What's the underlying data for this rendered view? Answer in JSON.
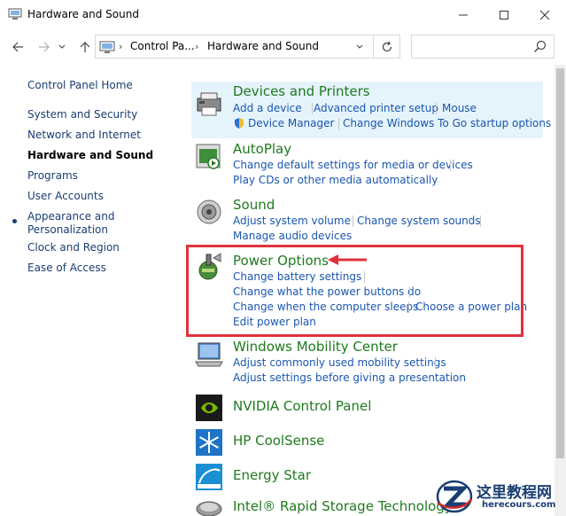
{
  "window": {
    "title": "Hardware and Sound",
    "minimize": "minimize",
    "maximize": "maximize",
    "close": "close"
  },
  "address": {
    "part1": "Control Pa...",
    "part2": "Hardware and Sound",
    "sep": "›",
    "search_placeholder": ""
  },
  "leftnav": {
    "home": "Control Panel Home",
    "items": [
      "System and Security",
      "Network and Internet",
      "Hardware and Sound",
      "Programs",
      "User Accounts",
      "Appearance and",
      "Personalization",
      "Clock and Region",
      "Ease of Access"
    ]
  },
  "categories": {
    "devices": {
      "title": "Devices and Printers",
      "links": [
        "Add a device",
        "Advanced printer setup",
        "Mouse",
        "Device Manager",
        "Change Windows To Go startup options"
      ]
    },
    "autoplay": {
      "title": "AutoPlay",
      "links": [
        "Change default settings for media or devices",
        "Play CDs or other media automatically"
      ]
    },
    "sound": {
      "title": "Sound",
      "links": [
        "Adjust system volume",
        "Change system sounds",
        "Manage audio devices"
      ]
    },
    "power": {
      "title": "Power Options",
      "links": [
        "Change battery settings",
        "Change what the power buttons do",
        "Change when the computer sleeps",
        "Choose a power plan",
        "Edit power plan"
      ]
    },
    "mobility": {
      "title": "Windows Mobility Center",
      "links": [
        "Adjust commonly used mobility settings",
        "Adjust settings before giving a presentation"
      ]
    },
    "nvidia": {
      "title": "NVIDIA Control Panel"
    },
    "coolsense": {
      "title": "HP CoolSense"
    },
    "energystar": {
      "title": "Energy Star"
    },
    "intel": {
      "title": "Intel® Rapid Storage Technology"
    }
  },
  "watermark": {
    "text": "这里教程网",
    "url": "herecours.com"
  },
  "colors": {
    "link": "#1a56b0",
    "title": "#1e7a1e",
    "highlight": "#e5f3fb",
    "annotation": "#e0323c"
  }
}
